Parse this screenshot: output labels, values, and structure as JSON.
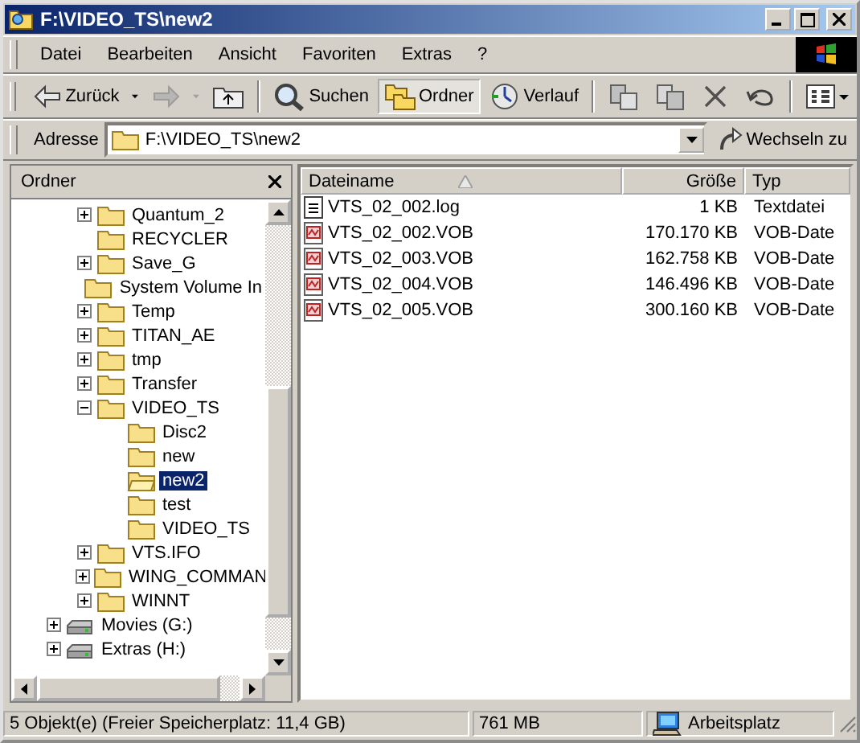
{
  "window": {
    "title": "F:\\VIDEO_TS\\new2"
  },
  "menu": [
    "Datei",
    "Bearbeiten",
    "Ansicht",
    "Favoriten",
    "Extras",
    "?"
  ],
  "toolbar": [
    {
      "kind": "back",
      "label": "Zurück",
      "disabled": false,
      "selected": false
    },
    {
      "kind": "forward",
      "disabled": true,
      "selected": false
    },
    {
      "kind": "up",
      "disabled": false,
      "selected": false
    },
    {
      "kind": "search",
      "label": "Suchen",
      "disabled": false,
      "selected": false
    },
    {
      "kind": "folders",
      "label": "Ordner",
      "disabled": false,
      "selected": true
    },
    {
      "kind": "history",
      "label": "Verlauf",
      "disabled": false,
      "selected": false
    },
    {
      "kind": "move",
      "disabled": false,
      "selected": false
    },
    {
      "kind": "copy",
      "disabled": false,
      "selected": false
    },
    {
      "kind": "delete",
      "disabled": false,
      "selected": false
    },
    {
      "kind": "undo",
      "disabled": false,
      "selected": false
    },
    {
      "kind": "views",
      "disabled": false,
      "selected": false
    }
  ],
  "address": {
    "label": "Adresse",
    "value": "F:\\VIDEO_TS\\new2",
    "go": "Wechseln zu"
  },
  "tree": {
    "title": "Ordner",
    "folders": [
      {
        "name": "Quantum_2",
        "expandable": true,
        "expanded": false,
        "selected": false
      },
      {
        "name": "RECYCLER",
        "expandable": false,
        "selected": false
      },
      {
        "name": "Save_G",
        "expandable": true,
        "expanded": false,
        "selected": false
      },
      {
        "name": "System Volume In",
        "expandable": false,
        "selected": false
      },
      {
        "name": "Temp",
        "expandable": true,
        "expanded": false,
        "selected": false
      },
      {
        "name": "TITAN_AE",
        "expandable": true,
        "expanded": false,
        "selected": false
      },
      {
        "name": "tmp",
        "expandable": true,
        "expanded": false,
        "selected": false
      },
      {
        "name": "Transfer",
        "expandable": true,
        "expanded": false,
        "selected": false
      },
      {
        "name": "VIDEO_TS",
        "expandable": true,
        "expanded": true,
        "selected": false,
        "children": [
          {
            "name": "Disc2",
            "expandable": false,
            "selected": false
          },
          {
            "name": "new",
            "expandable": false,
            "selected": false
          },
          {
            "name": "new2",
            "expandable": false,
            "selected": true
          },
          {
            "name": "test",
            "expandable": false,
            "selected": false
          },
          {
            "name": "VIDEO_TS",
            "expandable": false,
            "selected": false
          }
        ]
      },
      {
        "name": "VTS.IFO",
        "expandable": true,
        "expanded": false,
        "selected": false
      },
      {
        "name": "WING_COMMAN",
        "expandable": true,
        "expanded": false,
        "selected": false
      },
      {
        "name": "WINNT",
        "expandable": true,
        "expanded": false,
        "selected": false
      }
    ],
    "drives": [
      {
        "name": "Movies (G:)",
        "expandable": true,
        "expanded": false,
        "selected": false
      },
      {
        "name": "Extras (H:)",
        "expandable": true,
        "expanded": false,
        "selected": false
      }
    ]
  },
  "files": {
    "columns": [
      "Dateiname",
      "Größe",
      "Typ"
    ],
    "rows": [
      {
        "kind": "text",
        "name": "VTS_02_002.log",
        "size": "1 KB",
        "type": "Textdatei",
        "selected": false
      },
      {
        "kind": "video",
        "name": "VTS_02_002.VOB",
        "size": "170.170 KB",
        "type": "VOB-Date",
        "selected": false
      },
      {
        "kind": "video",
        "name": "VTS_02_003.VOB",
        "size": "162.758 KB",
        "type": "VOB-Date",
        "selected": false
      },
      {
        "kind": "video",
        "name": "VTS_02_004.VOB",
        "size": "146.496 KB",
        "type": "VOB-Date",
        "selected": false
      },
      {
        "kind": "video",
        "name": "VTS_02_005.VOB",
        "size": "300.160 KB",
        "type": "VOB-Date",
        "selected": false
      }
    ]
  },
  "status_bar": {
    "objects": "5 Objekt(e)  (Freier Speicherplatz: 11,4 GB)",
    "size": "761 MB",
    "zone": "Arbeitsplatz"
  }
}
